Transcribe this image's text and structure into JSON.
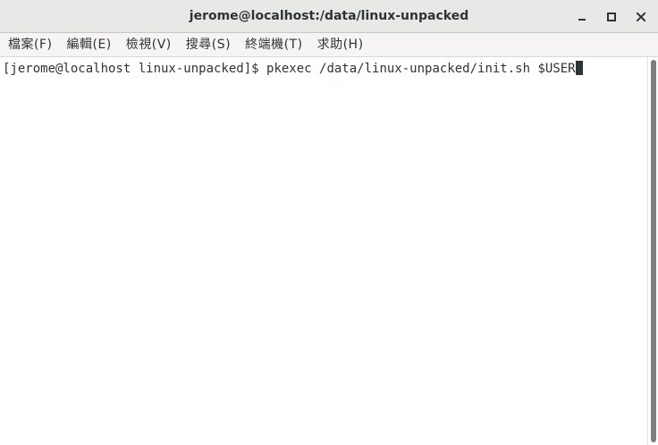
{
  "window": {
    "title": "jerome@localhost:/data/linux-unpacked",
    "buttons": {
      "minimize": "–",
      "maximize": "□",
      "close": "×"
    }
  },
  "menubar": {
    "items": [
      {
        "label": "檔案(F)"
      },
      {
        "label": "編輯(E)"
      },
      {
        "label": "檢視(V)"
      },
      {
        "label": "搜尋(S)"
      },
      {
        "label": "終端機(T)"
      },
      {
        "label": "求助(H)"
      }
    ]
  },
  "terminal": {
    "prompt": "[jerome@localhost linux-unpacked]$ ",
    "command": "pkexec /data/linux-unpacked/init.sh $USER"
  },
  "colors": {
    "titlebar_bg": "#e8e8e7",
    "menubar_bg": "#f6f5f4",
    "text": "#2e3436",
    "terminal_bg": "#ffffff"
  }
}
